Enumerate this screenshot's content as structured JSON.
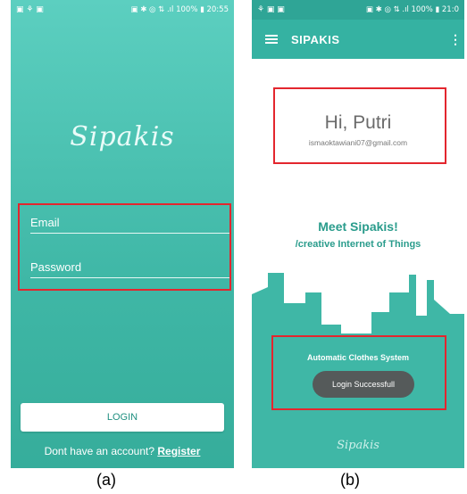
{
  "screen_a": {
    "status": {
      "left_icons": "▣ ⚘ ▣",
      "right": "▣ ✱ ◎ ⇅ .ıl 100% ▮ 20:55"
    },
    "logo": "Sipakis",
    "email_placeholder": "Email",
    "password_placeholder": "Password",
    "login_label": "LOGIN",
    "register_prompt": "Dont have an account?",
    "register_link": "Register"
  },
  "screen_b": {
    "status": {
      "left_icons": "⚘ ▣ ▣",
      "right": "▣ ✱ ◎ ⇅ .ıl 100% ▮ 21:0"
    },
    "app_title": "SIPAKIS",
    "greeting": "Hi, Putri",
    "email": "ismaoktawiani07@gmail.com",
    "meet_title": "Meet Sipakis!",
    "tagline": "/creative Internet of Things",
    "system_title": "Automatic Clothes System",
    "toast": "Login Successfull",
    "logo": "Sipakis"
  },
  "captions": {
    "a": "(a)",
    "b": "(b)"
  },
  "colors": {
    "teal": "#3fb7a6",
    "app_bar": "#35b2a2",
    "highlight": "#e3262e",
    "toast_bg": "#555a5a"
  },
  "icons": {
    "menu": "hamburger-menu-icon",
    "overflow": "overflow-menu-icon"
  }
}
